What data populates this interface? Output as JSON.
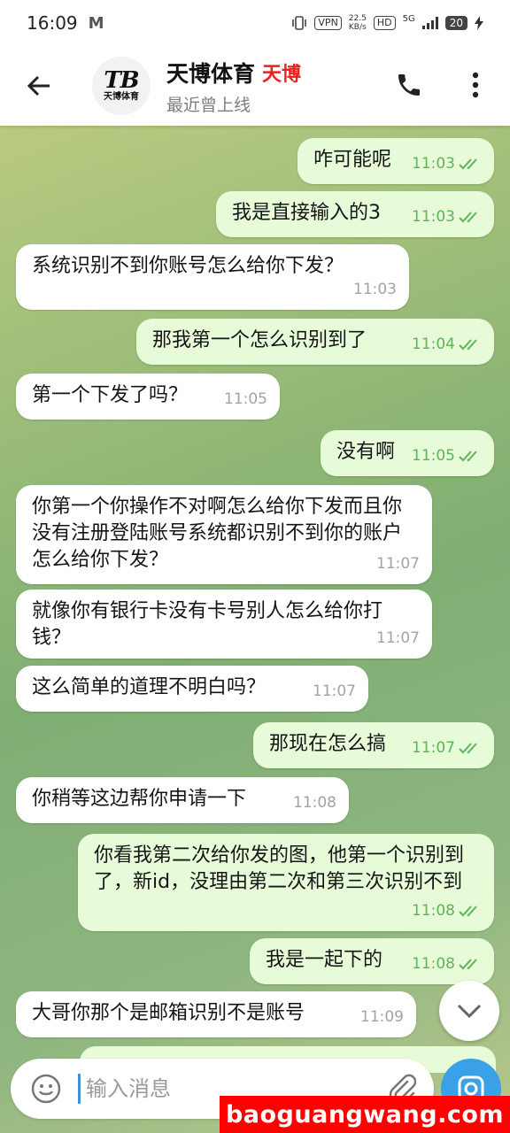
{
  "status_bar": {
    "time": "16:09",
    "m_icon": "M",
    "vpn": "VPN",
    "speed_top": "22.5",
    "speed_bottom": "KB/s",
    "hd": "HD",
    "signal": "5G",
    "battery": "20"
  },
  "header": {
    "title": "天博体育",
    "tag": "天博",
    "status": "最近曾上线",
    "logo_big": "TB",
    "logo_small": "天博体育"
  },
  "messages": [
    {
      "dir": "out",
      "text": "咋可能呢",
      "time": "11:03"
    },
    {
      "dir": "out",
      "text": "我是直接输入的3",
      "time": "11:03"
    },
    {
      "dir": "in",
      "text": "系统识别不到你账号怎么给你下发？",
      "time": "11:03"
    },
    {
      "dir": "out",
      "text": "那我第一个怎么识别到了",
      "time": "11:04"
    },
    {
      "dir": "in",
      "text": "第一个下发了吗？",
      "time": "11:05"
    },
    {
      "dir": "out",
      "text": "没有啊",
      "time": "11:05"
    },
    {
      "dir": "in",
      "text": "你第一个你操作不对啊怎么给你下发而且你没有注册登陆账号系统都识别不到你的账户怎么给你下发？",
      "time": "11:07"
    },
    {
      "dir": "in",
      "text": "就像你有银行卡没有卡号别人怎么给你打钱？",
      "time": "11:07"
    },
    {
      "dir": "in",
      "text": "这么简单的道理不明白吗？",
      "time": "11:07"
    },
    {
      "dir": "out",
      "text": "那现在怎么搞",
      "time": "11:07"
    },
    {
      "dir": "in",
      "text": "你稍等这边帮你申请一下",
      "time": "11:08"
    },
    {
      "dir": "out",
      "text": "你看我第二次给你发的图，他第一个识别到了，新id，没理由第二次和第三次识别不到",
      "time": "11:08"
    },
    {
      "dir": "out",
      "text": "我是一起下的",
      "time": "11:08"
    },
    {
      "dir": "in",
      "text": "大哥你那个是邮箱识别不是账号",
      "time": "11:09"
    }
  ],
  "input": {
    "placeholder": "输入消息"
  },
  "watermark": "baoguangwang.com",
  "colors": {
    "outgoing_bubble": "#e7fbd9",
    "incoming_bubble": "#ffffff",
    "read_check": "#5fb35a",
    "camera_button": "#3aa0e8",
    "watermark_bg": "#ff0000",
    "tag_red": "#e8231e"
  },
  "icons": [
    "back-arrow-icon",
    "phone-icon",
    "more-vert-icon",
    "double-check-icon",
    "chevron-down-icon",
    "emoji-icon",
    "paperclip-icon",
    "camera-icon"
  ]
}
